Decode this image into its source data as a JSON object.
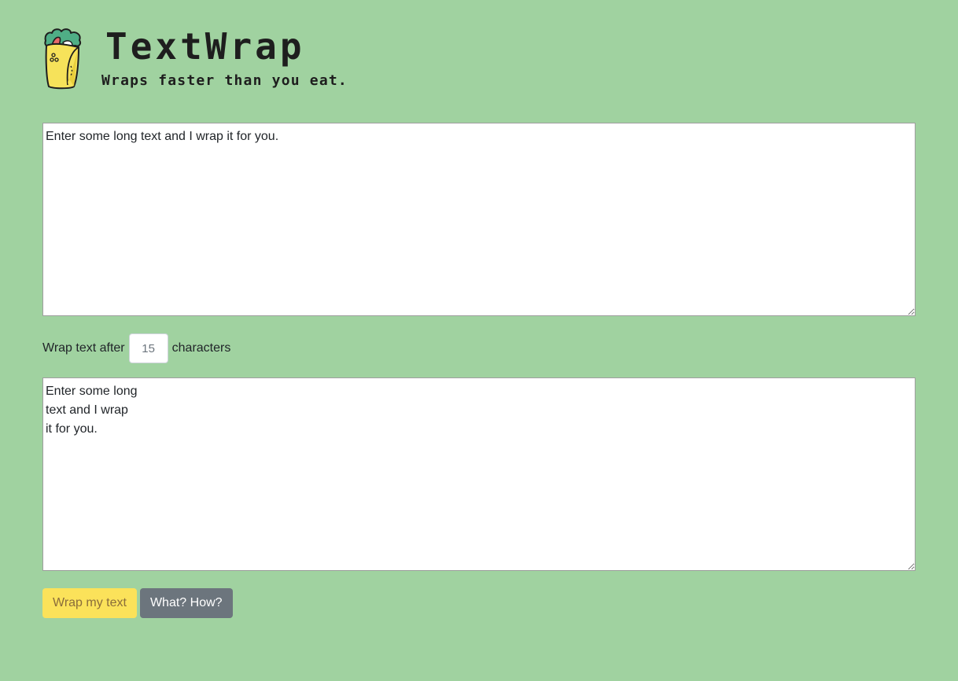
{
  "header": {
    "title": "TextWrap",
    "tagline": "Wraps faster than you eat.",
    "logo_icon": "burrito-icon"
  },
  "input": {
    "value": "Enter some long text and I wrap it for you."
  },
  "wrap_setting": {
    "prefix": "Wrap text after",
    "value": "15",
    "suffix": "characters"
  },
  "output": {
    "value": "Enter some long\ntext and I wrap\nit for you."
  },
  "buttons": {
    "wrap_label": "Wrap my text",
    "how_label": "What? How?"
  },
  "colors": {
    "background": "#a0d2a0",
    "primary_button": "#fbe25a",
    "secondary_button": "#6c757d"
  }
}
